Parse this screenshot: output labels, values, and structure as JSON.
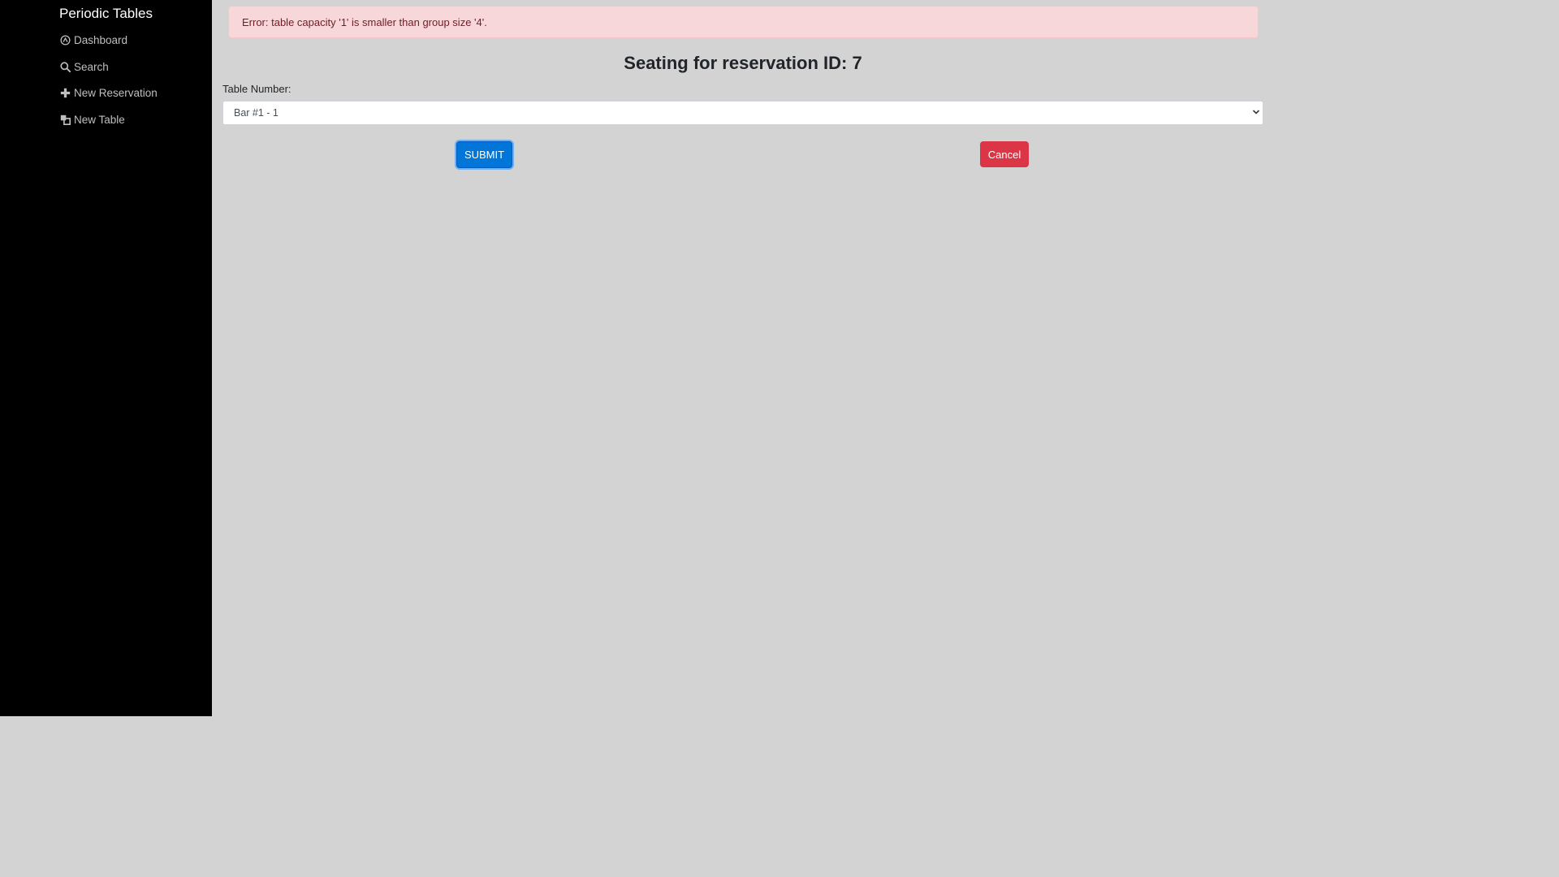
{
  "sidebar": {
    "brand": "Periodic Tables",
    "items": [
      {
        "label": "Dashboard",
        "icon": "dashboard-icon"
      },
      {
        "label": "Search",
        "icon": "search-icon"
      },
      {
        "label": "New Reservation",
        "icon": "plus-icon"
      },
      {
        "label": "New Table",
        "icon": "layers-icon"
      }
    ]
  },
  "alert": {
    "message": "Error: table capacity '1' is smaller than group size '4'."
  },
  "page": {
    "title": "Seating for reservation ID: 7"
  },
  "form": {
    "table_label": "Table Number:",
    "table_selected": "Bar #1 - 1",
    "submit_label": "SUBMIT",
    "cancel_label": "Cancel"
  },
  "colors": {
    "sidebar_bg": "#000000",
    "main_bg": "#d3d3d3",
    "alert_bg": "#f8d7da",
    "alert_text": "#721c24",
    "submit_bg": "#0275d8",
    "cancel_bg": "#dc3545"
  }
}
